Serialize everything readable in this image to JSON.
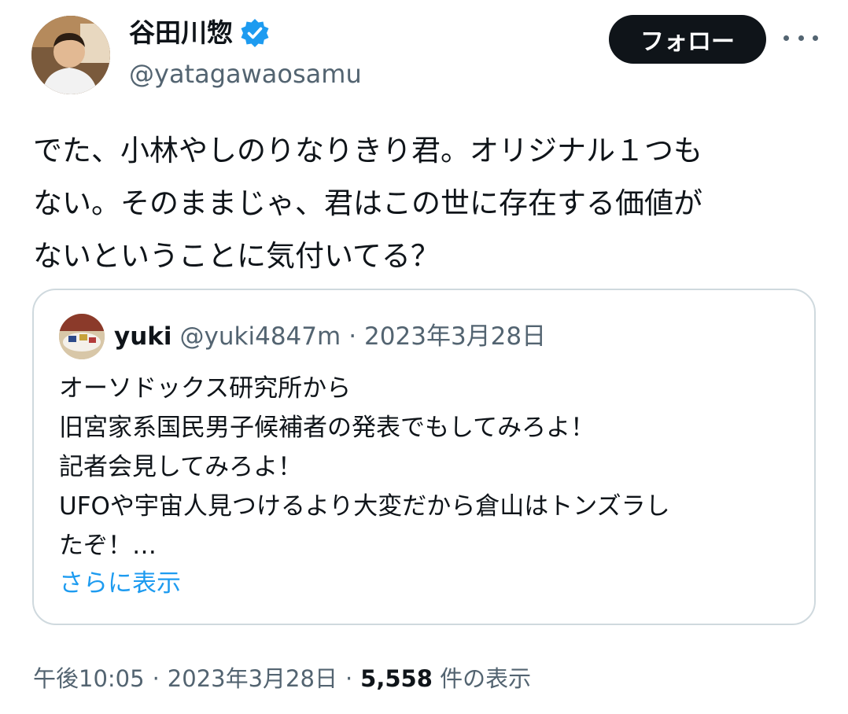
{
  "author": {
    "display_name": "谷田川惣",
    "handle": "@yatagawaosamu",
    "avatar_icon": "user-photo-avatar",
    "verified_icon": "verified-badge-icon",
    "verified_color": "#1d9bf0"
  },
  "actions": {
    "follow_label": "フォロー",
    "more_icon": "more-options-icon"
  },
  "tweet": {
    "text": "でた、小林やしのりなりきり君。オリジナル１つも\nない。そのままじゃ、君はこの世に存在する価値が\nないということに気付いてる？"
  },
  "quoted_tweet": {
    "display_name": "yuki",
    "handle": "@yuki4847m",
    "separator": "·",
    "date": "2023年3月28日",
    "body": "オーソドックス研究所から\n旧宮家系国民男子候補者の発表でもしてみろよ！\n記者会見してみろよ！\nUFOや宇宙人見つけるより大変だから倉山はトンズラし\nたぞ！…",
    "show_more_label": "さらに表示"
  },
  "meta": {
    "time": "午後10:05",
    "sep1": "·",
    "date": "2023年3月28日",
    "sep2": "·",
    "views_count": "5,558",
    "views_label": "件の表示"
  },
  "colors": {
    "text_primary": "#0f1419",
    "text_secondary": "#536471",
    "link": "#1d9bf0",
    "border": "#cfd9de"
  }
}
